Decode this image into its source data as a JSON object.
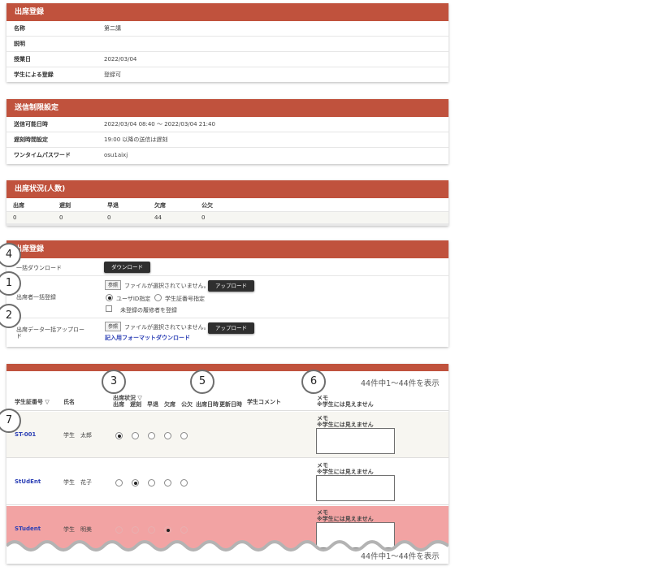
{
  "attendance": {
    "title": "出席登録",
    "rows": [
      {
        "label": "名称",
        "value": "第二講"
      },
      {
        "label": "説明",
        "value": ""
      },
      {
        "label": "授業日",
        "value": "2022/03/04"
      },
      {
        "label": "学生による登録",
        "value": "登録可"
      }
    ]
  },
  "limits": {
    "title": "送信制限設定",
    "rows": [
      {
        "label": "送信可能日時",
        "value": "2022/03/04 08:40 ～ 2022/03/04 21:40"
      },
      {
        "label": "遅刻時間設定",
        "value": "19:00 以降の送信は遅刻"
      },
      {
        "label": "ワンタイムパスワード",
        "value": "osu1aixj"
      }
    ]
  },
  "status": {
    "title": "出席状況(人数)",
    "headers": [
      "出席",
      "遅刻",
      "早退",
      "欠席",
      "公欠"
    ],
    "values": [
      "0",
      "0",
      "0",
      "44",
      "0"
    ]
  },
  "bulk": {
    "title": "出席登録",
    "download_label": "一括ダウンロード",
    "download_button": "ダウンロード",
    "attendee_label": "出席者一括登録",
    "browse_button": "参照",
    "no_file": "ファイルが選択されていません。",
    "upload_button": "アップロード",
    "radio_userid": "ユーザID指定",
    "radio_studentid": "学生証番号指定",
    "checkbox_unregistered": "未登録の履修者を登録",
    "data_upload_label_1": "出席データ一括アップロー",
    "data_upload_label_2": "ド",
    "format_link": "記入用フォーマットダウンロード"
  },
  "table": {
    "count_text": "44件中1～44件を表示",
    "count_text_bottom": "44件中1～44件を表示",
    "col_student_id": "学生証番号 ▽",
    "col_name": "氏名",
    "col_status_title": "出席状況 ▽",
    "col_status_sub": "出席　遅刻　早退　欠席　公欠",
    "col_datetime": "出席日時",
    "col_updated": "更新日時",
    "col_comment": "学生コメント",
    "col_memo": "メモ",
    "col_memo_note": "※学生には見えません",
    "memo_label": "メモ",
    "memo_note": "※学生には見えません",
    "rows": [
      {
        "id": "ST-001",
        "name": "学生　太郎",
        "selected": 0
      },
      {
        "id": "StUdEnt",
        "name": "学生　花子",
        "selected": 1
      },
      {
        "id": "STudent",
        "name": "学生　明美",
        "selected": 3
      }
    ]
  },
  "badges": [
    "4",
    "1",
    "2",
    "3",
    "5",
    "6",
    "7"
  ],
  "colors": {
    "header": "#c0523d",
    "row_highlight": "#f2a3a3",
    "link": "#2b3fb5"
  }
}
